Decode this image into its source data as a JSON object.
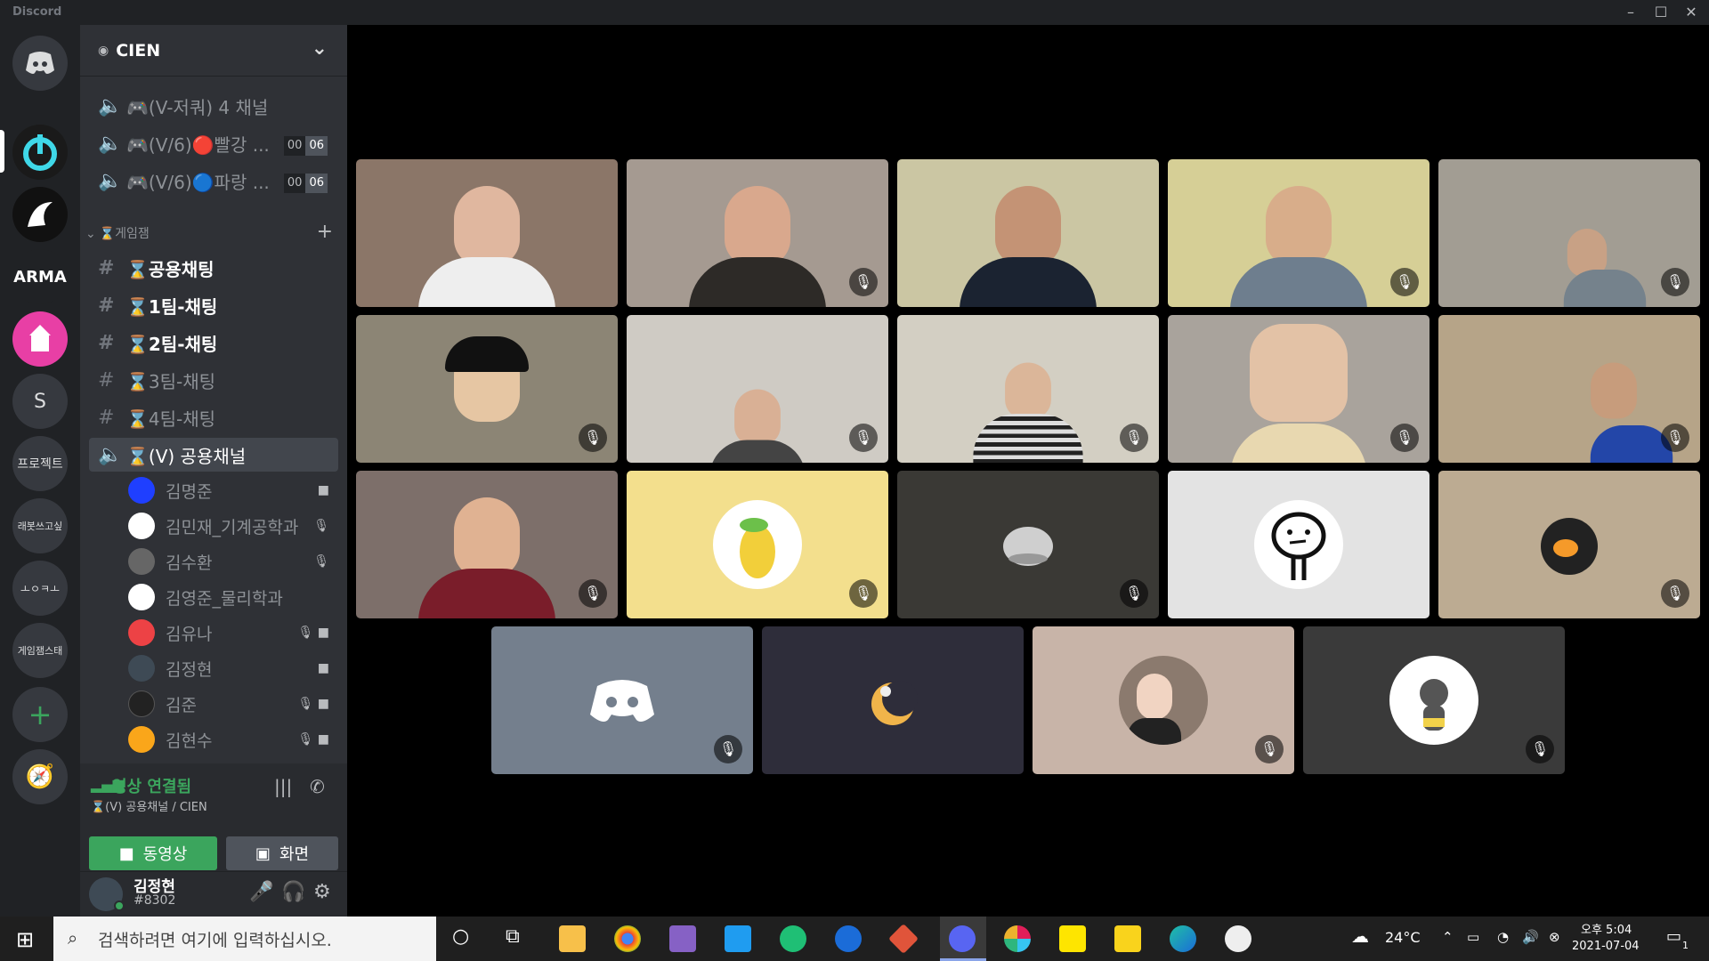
{
  "window": {
    "title": "Discord"
  },
  "server": {
    "name": "CIEN"
  },
  "voice_channels_top": [
    {
      "label": "🎮(V-저쿼) 4 채널"
    },
    {
      "label": "🎮(V/6)🔴빨강 ...",
      "count_a": "00",
      "count_b": "06"
    },
    {
      "label": "🎮(V/6)🔵파랑 ...",
      "count_a": "00",
      "count_b": "06"
    }
  ],
  "category": {
    "label": "⌛게임잼"
  },
  "text_channels": [
    {
      "label": "⌛공용채팅"
    },
    {
      "label": "⌛1팀-채팅"
    },
    {
      "label": "⌛2팀-채팅"
    },
    {
      "label": "⌛3팀-채팅"
    },
    {
      "label": "⌛4팀-채팅"
    }
  ],
  "active_voice": {
    "label": "⌛(V) 공용채널"
  },
  "members": [
    {
      "name": "김명준",
      "color": "#1f3fff"
    },
    {
      "name": "김민재_기계공학과",
      "color": "#ffffff"
    },
    {
      "name": "김수환",
      "color": "#666666"
    },
    {
      "name": "김영준_물리학과",
      "color": "#ffffff"
    },
    {
      "name": "김유나",
      "color": "#ed4245"
    },
    {
      "name": "김정현",
      "color": "#3e4a55"
    },
    {
      "name": "김준",
      "color": "#222222"
    },
    {
      "name": "김현수",
      "color": "#faa61a"
    }
  ],
  "voice_panel": {
    "status": "영상 연결됨",
    "channel": "⌛(V) 공용채널 / CIEN",
    "video_label": "동영상",
    "screen_label": "화면"
  },
  "user": {
    "name": "김정현",
    "tag": "#8302"
  },
  "guilds": [
    {
      "label": "S"
    },
    {
      "label": "프로젝트"
    },
    {
      "label": "래봇쓰고싶"
    },
    {
      "label": "ㅗㅇㅋㅗ"
    },
    {
      "label": "게임잼스태"
    }
  ],
  "taskbar": {
    "search_placeholder": "검색하려면 여기에 입력하십시오.",
    "weather": "24°C",
    "time": "오후 5:04",
    "date": "2021-07-04",
    "notif_count": "1"
  }
}
